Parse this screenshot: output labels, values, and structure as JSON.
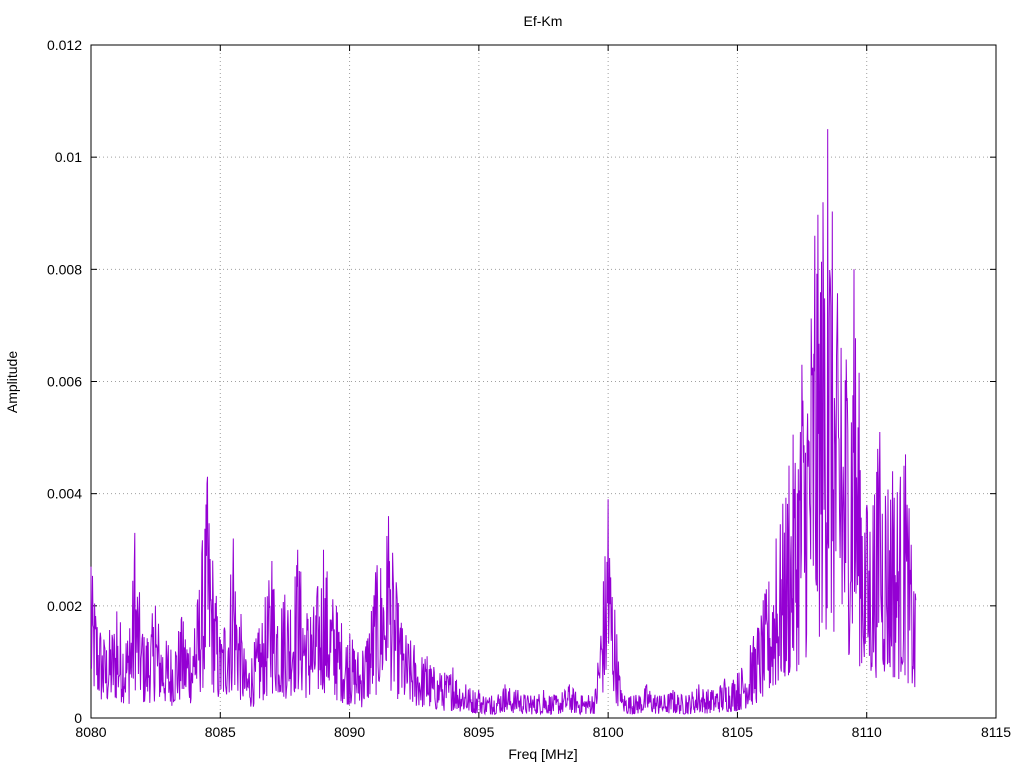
{
  "chart_data": {
    "type": "line",
    "title": "Ef-Km",
    "xlabel": "Freq [MHz]",
    "ylabel": "Amplitude",
    "xlim": [
      8080,
      8115
    ],
    "ylim": [
      0,
      0.012
    ],
    "x_ticks": [
      8080,
      8085,
      8090,
      8095,
      8100,
      8105,
      8110,
      8115
    ],
    "x_tick_labels": [
      "8080",
      "8085",
      "8090",
      "8095",
      "8100",
      "8105",
      "8110",
      "8115"
    ],
    "y_ticks": [
      0,
      0.002,
      0.004,
      0.006,
      0.008,
      0.01,
      0.012
    ],
    "y_tick_labels": [
      "0",
      "0.002",
      "0.004",
      "0.006",
      "0.008",
      "0.01",
      "0.012"
    ],
    "grid": true,
    "legend": "none",
    "series": [
      {
        "color": "#9400d3",
        "x": [
          8080.0,
          8080.5,
          8081.0,
          8081.5,
          8081.7,
          8082.0,
          8082.5,
          8083.0,
          8083.5,
          8084.0,
          8084.5,
          8085.0,
          8085.5,
          8086.0,
          8086.5,
          8087.0,
          8087.5,
          8088.0,
          8088.5,
          8089.0,
          8089.5,
          8090.0,
          8090.5,
          8091.0,
          8091.5,
          8092.0,
          8092.5,
          8093.0,
          8093.5,
          8094.0,
          8094.5,
          8095.0,
          8095.5,
          8096.0,
          8096.5,
          8097.0,
          8097.5,
          8098.0,
          8098.5,
          8099.0,
          8099.5,
          8100.0,
          8100.5,
          8101.0,
          8101.5,
          8102.0,
          8102.5,
          8103.0,
          8103.5,
          8104.0,
          8104.5,
          8105.0,
          8105.5,
          8106.0,
          8106.5,
          8107.0,
          8107.5,
          8108.0,
          8108.5,
          8109.0,
          8109.5,
          8110.0,
          8110.5,
          8111.0,
          8111.5,
          8111.9
        ],
        "y": [
          0.0027,
          0.0014,
          0.0019,
          0.0016,
          0.0033,
          0.0015,
          0.002,
          0.0013,
          0.0018,
          0.0016,
          0.0043,
          0.0014,
          0.0032,
          0.001,
          0.0016,
          0.0028,
          0.0022,
          0.003,
          0.0018,
          0.003,
          0.002,
          0.0015,
          0.0012,
          0.0026,
          0.0036,
          0.0017,
          0.0013,
          0.0011,
          0.0008,
          0.0009,
          0.0006,
          0.0005,
          0.0004,
          0.0006,
          0.0005,
          0.0004,
          0.0005,
          0.0004,
          0.0006,
          0.0004,
          0.0005,
          0.0039,
          0.0005,
          0.0004,
          0.0006,
          0.0004,
          0.0005,
          0.0004,
          0.0006,
          0.0005,
          0.0007,
          0.0008,
          0.0013,
          0.0021,
          0.0032,
          0.0045,
          0.0063,
          0.0086,
          0.0105,
          0.0066,
          0.008,
          0.0038,
          0.0051,
          0.0044,
          0.0047,
          0.0021
        ]
      }
    ]
  }
}
